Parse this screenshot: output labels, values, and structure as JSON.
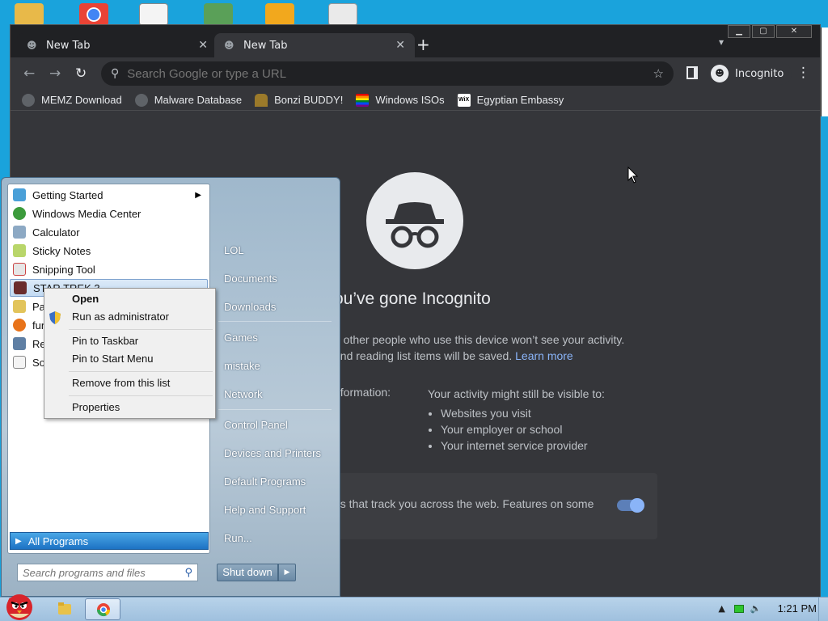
{
  "chrome": {
    "tabs": [
      {
        "label": "New Tab"
      },
      {
        "label": "New Tab"
      }
    ],
    "omnibox_placeholder": "Search Google or type a URL",
    "profile_label": "Incognito",
    "bookmarks": [
      {
        "label": "MEMZ Download"
      },
      {
        "label": "Malware Database"
      },
      {
        "label": "Bonzi BUDDY!"
      },
      {
        "label": "Windows ISOs"
      },
      {
        "label": "Egyptian Embassy"
      }
    ],
    "page": {
      "title": "ou’ve gone Incognito",
      "desc_line1": "d other people who use this device won’t see your activity.",
      "desc_line2": "and reading list items will be saved.",
      "learn_more": "Learn more",
      "left_col": "nformation:",
      "right_title": "Your activity might still be visible to:",
      "right_items": [
        "Websites you visit",
        "Your employer or school",
        "Your internet service provider"
      ],
      "cookie_text": "es that track you across the web. Features on some"
    }
  },
  "start_menu": {
    "programs": [
      {
        "label": "Getting Started"
      },
      {
        "label": "Windows Media Center"
      },
      {
        "label": "Calculator"
      },
      {
        "label": "Sticky Notes"
      },
      {
        "label": "Snipping Tool"
      },
      {
        "label": "STAR TREK 3"
      },
      {
        "label": "Pai"
      },
      {
        "label": "fun"
      },
      {
        "label": "Rer"
      },
      {
        "label": "Sol"
      }
    ],
    "all_programs": "All Programs",
    "search_placeholder": "Search programs and files",
    "right_items": [
      "LOL",
      "Documents",
      "Downloads",
      "Games",
      "mistake",
      "Network",
      "Control Panel",
      "Devices and Printers",
      "Default Programs",
      "Help and Support",
      "Run..."
    ],
    "shutdown": "Shut down"
  },
  "context_menu": {
    "items": [
      "Open",
      "Run as administrator",
      "Pin to Taskbar",
      "Pin to Start Menu",
      "Remove from this list",
      "Properties"
    ]
  },
  "taskbar": {
    "clock": "1:21 PM"
  }
}
